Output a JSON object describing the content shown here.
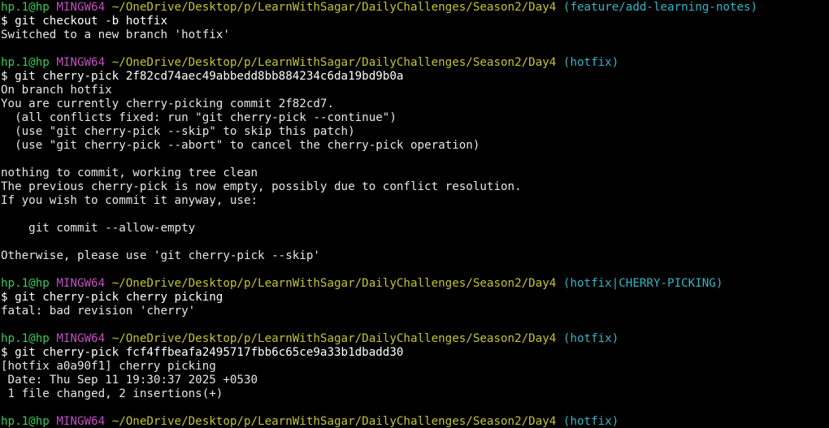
{
  "colors": {
    "background": "#000000",
    "foreground": "#ffffff",
    "user": "#39c95a",
    "host": "#c150c1",
    "path": "#c4c431",
    "branch": "#34b6c6"
  },
  "prompt": {
    "user": "hp.1@hp",
    "host": "MINGW64",
    "path": "~/OneDrive/Desktop/p/LearnWithSagar/DailyChallenges/Season2/Day4"
  },
  "lines": [
    {
      "type": "prompt",
      "branch": "(feature/add-learning-notes)"
    },
    {
      "type": "text",
      "text": "$ git checkout -b hotfix"
    },
    {
      "type": "text",
      "text": "Switched to a new branch 'hotfix'"
    },
    {
      "type": "text",
      "text": ""
    },
    {
      "type": "prompt",
      "branch": "(hotfix)"
    },
    {
      "type": "text",
      "text": "$ git cherry-pick 2f82cd74aec49abbedd8bb884234c6da19bd9b0a"
    },
    {
      "type": "text",
      "text": "On branch hotfix"
    },
    {
      "type": "text",
      "text": "You are currently cherry-picking commit 2f82cd7."
    },
    {
      "type": "text",
      "text": "  (all conflicts fixed: run \"git cherry-pick --continue\")"
    },
    {
      "type": "text",
      "text": "  (use \"git cherry-pick --skip\" to skip this patch)"
    },
    {
      "type": "text",
      "text": "  (use \"git cherry-pick --abort\" to cancel the cherry-pick operation)"
    },
    {
      "type": "text",
      "text": ""
    },
    {
      "type": "text",
      "text": "nothing to commit, working tree clean"
    },
    {
      "type": "text",
      "text": "The previous cherry-pick is now empty, possibly due to conflict resolution."
    },
    {
      "type": "text",
      "text": "If you wish to commit it anyway, use:"
    },
    {
      "type": "text",
      "text": ""
    },
    {
      "type": "text",
      "text": "    git commit --allow-empty"
    },
    {
      "type": "text",
      "text": ""
    },
    {
      "type": "text",
      "text": "Otherwise, please use 'git cherry-pick --skip'"
    },
    {
      "type": "text",
      "text": ""
    },
    {
      "type": "prompt",
      "branch": "(hotfix|CHERRY-PICKING)"
    },
    {
      "type": "text",
      "text": "$ git cherry-pick cherry picking"
    },
    {
      "type": "text",
      "text": "fatal: bad revision 'cherry'"
    },
    {
      "type": "text",
      "text": ""
    },
    {
      "type": "prompt",
      "branch": "(hotfix)"
    },
    {
      "type": "text",
      "text": "$ git cherry-pick fcf4ffbeafa2495717fbb6c65ce9a33b1dbadd30"
    },
    {
      "type": "text",
      "text": "[hotfix a0a90f1] cherry picking"
    },
    {
      "type": "text",
      "text": " Date: Thu Sep 11 19:30:37 2025 +0530"
    },
    {
      "type": "text",
      "text": " 1 file changed, 2 insertions(+)"
    },
    {
      "type": "text",
      "text": ""
    },
    {
      "type": "prompt",
      "branch": "(hotfix)"
    }
  ]
}
